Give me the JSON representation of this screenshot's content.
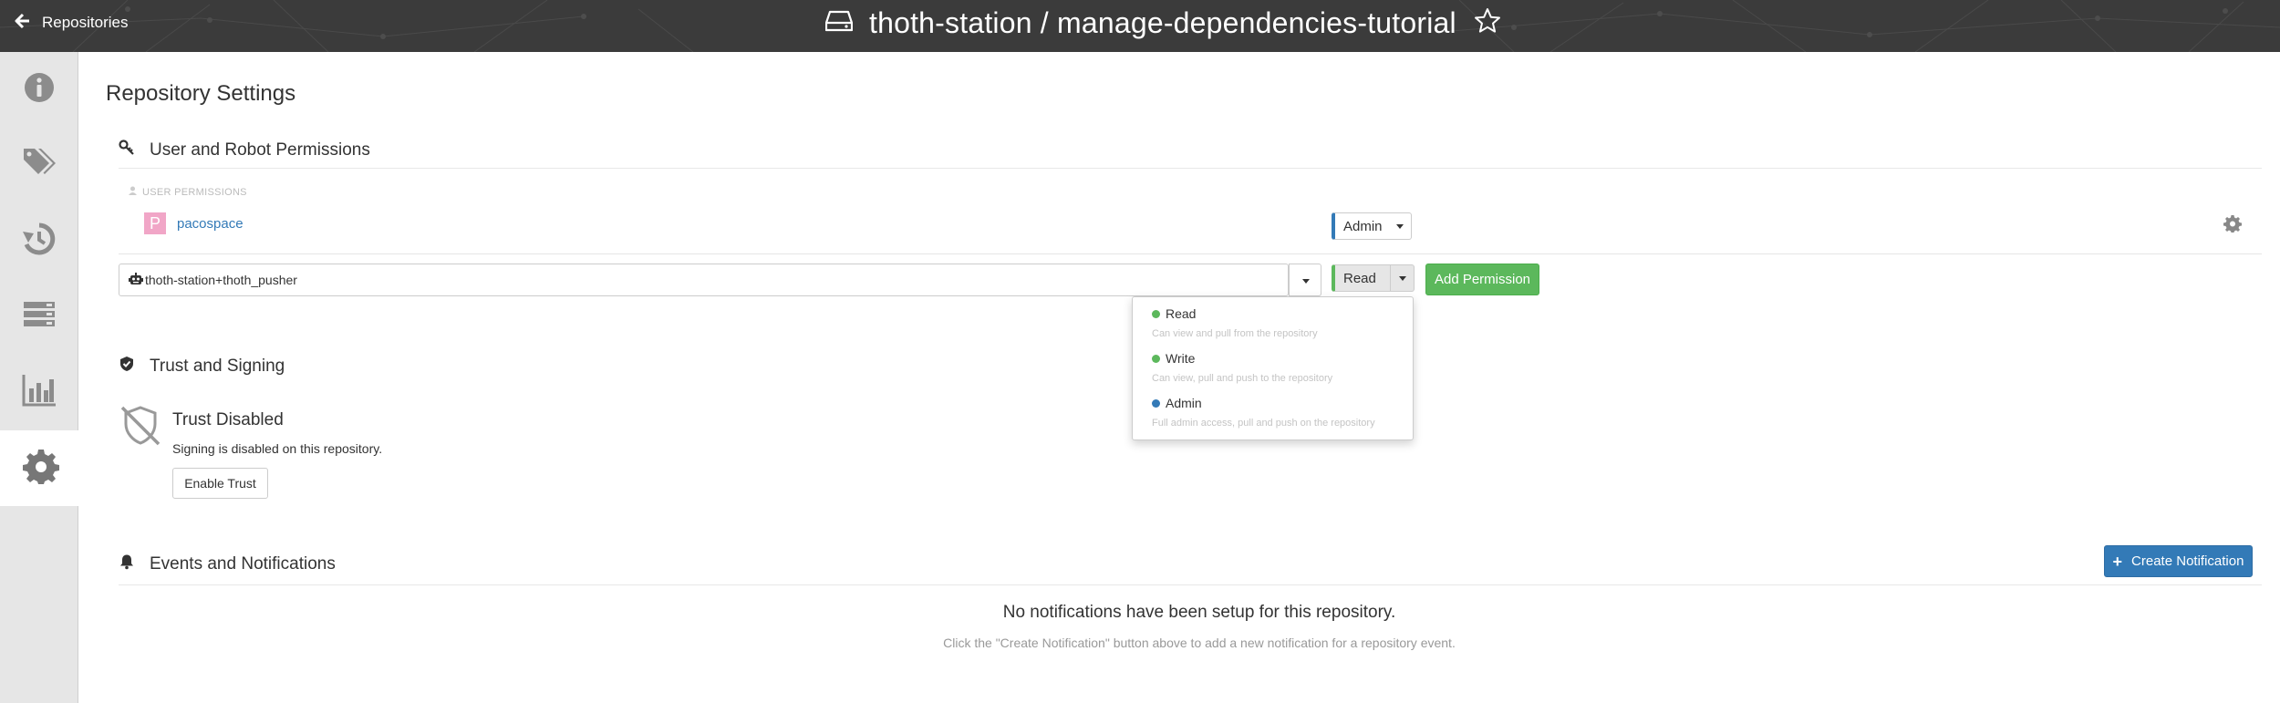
{
  "topbar": {
    "back_label": "Repositories",
    "repo_title": "thoth-station / manage-dependencies-tutorial",
    "background": "#3b3b3b"
  },
  "sidebar": {
    "items": [
      {
        "icon": "info-icon"
      },
      {
        "icon": "tags-icon"
      },
      {
        "icon": "history-icon"
      },
      {
        "icon": "builds-icon"
      },
      {
        "icon": "usage-chart-icon"
      },
      {
        "icon": "settings-gear-icon",
        "active": true
      }
    ]
  },
  "page": {
    "title": "Repository Settings"
  },
  "permissions": {
    "section_title": "User and Robot Permissions",
    "user_header": "USER PERMISSIONS",
    "rows": [
      {
        "avatar_letter": "P",
        "username": "pacospace",
        "role": "Admin"
      }
    ],
    "new_entity_value": "thoth-station+thoth_pusher",
    "new_role": "Read",
    "add_button": "Add Permission",
    "role_menu": [
      {
        "title": "Read",
        "desc": "Can view and pull from the repository",
        "color": "#5cb85c"
      },
      {
        "title": "Write",
        "desc": "Can view, pull and push to the repository",
        "color": "#5cb85c"
      },
      {
        "title": "Admin",
        "desc": "Full admin access, pull and push on the repository",
        "color": "#337ab7"
      }
    ]
  },
  "trust": {
    "section_title": "Trust and Signing",
    "title": "Trust Disabled",
    "desc": "Signing is disabled on this repository.",
    "button": "Enable Trust"
  },
  "notifications": {
    "section_title": "Events and Notifications",
    "create_button": "Create Notification",
    "empty_title": "No notifications have been setup for this repository.",
    "empty_desc": "Click the \"Create Notification\" button above to add a new notification for a repository event."
  },
  "colors": {
    "link": "#337ab7",
    "success": "#5cb85c",
    "primary": "#337ab7"
  }
}
